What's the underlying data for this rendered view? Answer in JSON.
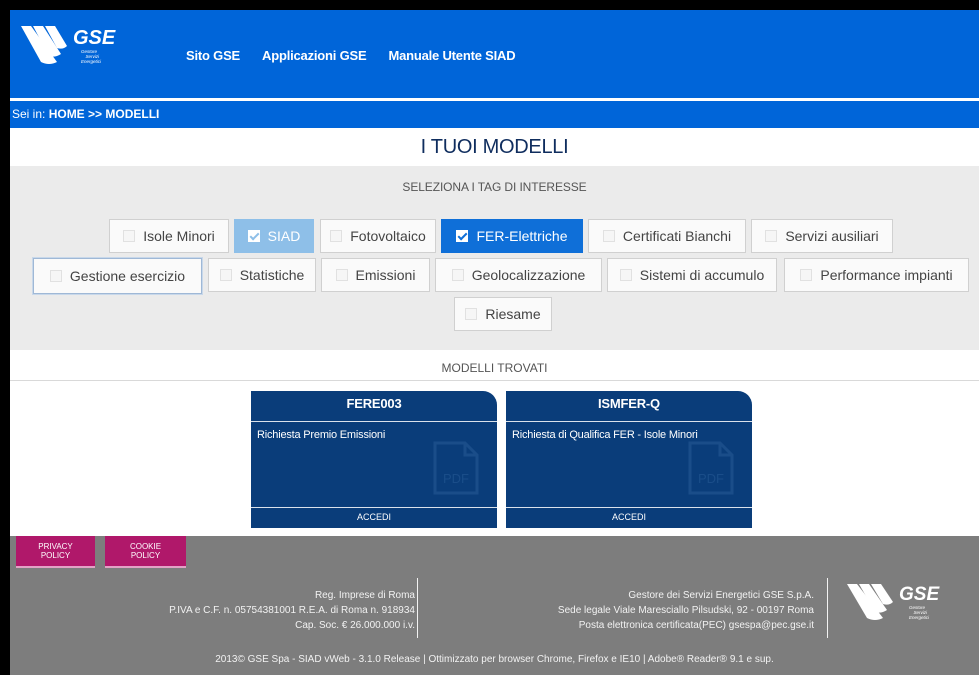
{
  "header": {
    "logo_text": "GSE",
    "logo_subtext": [
      "Gestore",
      "Servizi",
      "Energetici"
    ],
    "nav": [
      "Sito GSE",
      "Applicazioni GSE",
      "Manuale Utente SIAD"
    ]
  },
  "breadcrumb": {
    "prefix": "Sei in: ",
    "path": "HOME >> MODELLI"
  },
  "page_title": "I TUOI MODELLI",
  "tags": {
    "heading": "SELEZIONA I TAG DI INTERESSE",
    "items": [
      {
        "label": "Isole Minori",
        "checked": false
      },
      {
        "label": "SIAD",
        "checked": true,
        "state": "disabled"
      },
      {
        "label": "Fotovoltaico",
        "checked": false
      },
      {
        "label": "FER-Elettriche",
        "checked": true
      },
      {
        "label": "Certificati Bianchi",
        "checked": false
      },
      {
        "label": "Servizi ausiliari",
        "checked": false
      },
      {
        "label": "Gestione esercizio",
        "checked": false,
        "state": "focused"
      },
      {
        "label": "Statistiche",
        "checked": false
      },
      {
        "label": "Emissioni",
        "checked": false
      },
      {
        "label": "Geolocalizzazione",
        "checked": false
      },
      {
        "label": "Sistemi di accumulo",
        "checked": false
      },
      {
        "label": "Performance impianti",
        "checked": false
      },
      {
        "label": "Riesame",
        "checked": false
      }
    ]
  },
  "models": {
    "heading": "MODELLI TROVATI",
    "cards": [
      {
        "code": "FERE003",
        "description": "Richiesta Premio Emissioni",
        "icon": "pdf-file-icon",
        "action": "ACCEDI"
      },
      {
        "code": "ISMFER-Q",
        "description": "Richiesta di Qualifica FER - Isole Minori",
        "icon": "pdf-file-icon",
        "action": "ACCEDI"
      }
    ]
  },
  "footer": {
    "privacy": [
      "PRIVACY",
      "POLICY"
    ],
    "cookie": [
      "COOKIE",
      "POLICY"
    ],
    "left_lines": [
      "Reg. Imprese di Roma",
      "P.IVA e C.F. n. 05754381001 R.E.A. di Roma n. 918934",
      "Cap. Soc. € 26.000.000 i.v."
    ],
    "right_lines": [
      "Gestore dei Servizi Energetici GSE S.p.A.",
      "Sede legale Viale Maresciallo Pilsudski, 92 - 00197 Roma",
      "Posta elettronica certificata(PEC) gsespa@pec.gse.it"
    ],
    "bottom": "2013© GSE Spa - SIAD vWeb - 3.1.0 Release | Ottimizzato per browser Chrome, Firefox e IE10 | Adobe® Reader® 9.1 e sup."
  },
  "colors": {
    "header_blue": "#0065d9",
    "card_navy": "#0a3d7a",
    "footer_gray": "#7d7d7d",
    "policy_magenta": "#b0186a"
  }
}
